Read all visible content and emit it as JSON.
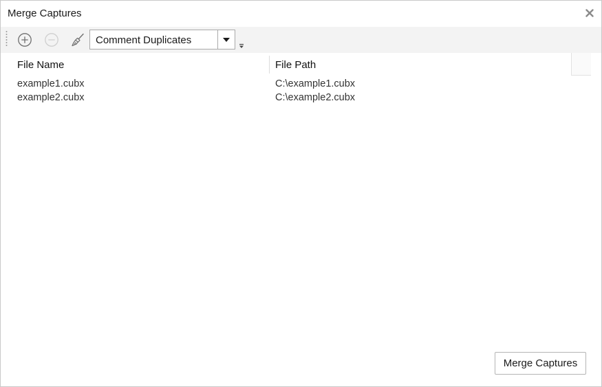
{
  "window": {
    "title": "Merge Captures"
  },
  "icons": {
    "close": "close-icon",
    "add": "plus-circle-icon",
    "remove": "minus-circle-icon",
    "clear": "broom-icon",
    "dropdown": "caret-down-icon",
    "overflow": "toolbar-overflow-icon",
    "grip": "toolbar-grip-icon"
  },
  "toolbar": {
    "mode_selected": "Comment Duplicates"
  },
  "grid": {
    "columns": [
      "File Name",
      "File Path"
    ],
    "rows": [
      {
        "name": "example1.cubx",
        "path": "C:\\example1.cubx"
      },
      {
        "name": "example2.cubx",
        "path": "C:\\example2.cubx"
      }
    ]
  },
  "footer": {
    "merge_label": "Merge Captures"
  },
  "colors": {
    "toolbar_bg": "#f3f3f3",
    "border": "#c8c8c8",
    "text": "#1e1e1e",
    "icon_disabled": "#cfcfcf"
  }
}
